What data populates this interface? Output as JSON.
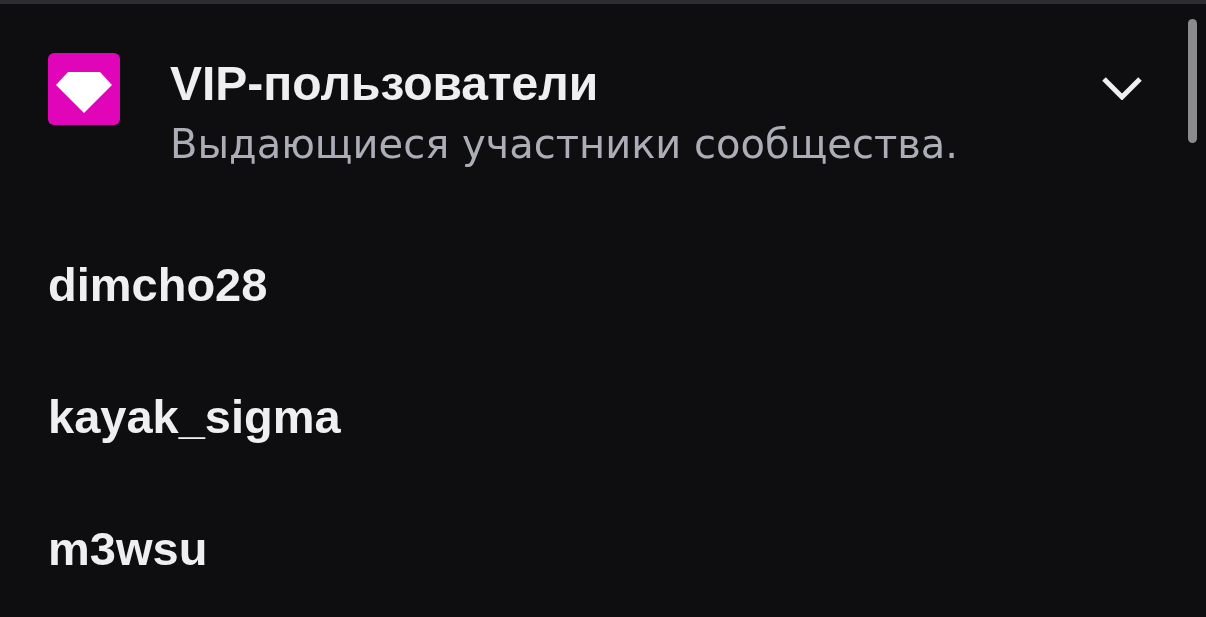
{
  "section": {
    "title": "VIP-пользователи",
    "subtitle": "Выдающиеся участники сообщества.",
    "expanded": true
  },
  "users": [
    {
      "name": "dimcho28"
    },
    {
      "name": "kayak_sigma"
    },
    {
      "name": "m3wsu"
    }
  ]
}
